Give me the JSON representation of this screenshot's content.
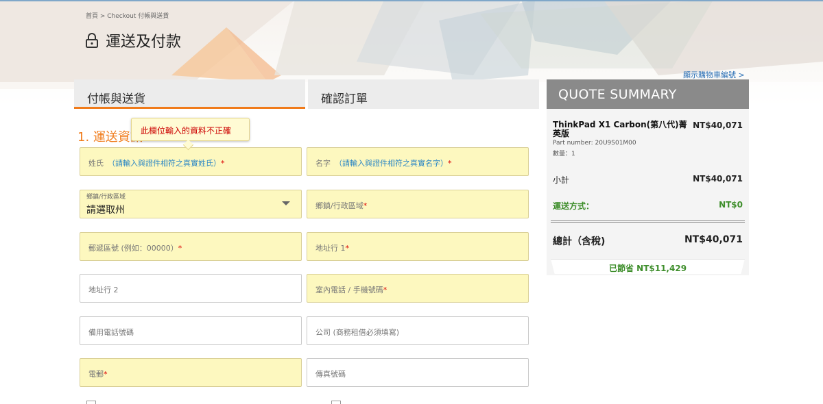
{
  "breadcrumb": "首頁 > Checkout 付帳與送貨",
  "page": {
    "title": "運送及付款"
  },
  "cart": {
    "show_number_link": "顯示購物車編號 >"
  },
  "tabs": {
    "billing": "付帳與送貨",
    "confirm": "確認訂單"
  },
  "section": {
    "title": "1. 運送資訊"
  },
  "tooltip": {
    "error": "此欄位輸入的資料不正確"
  },
  "form": {
    "last_name": {
      "label": "姓氏",
      "hint": "（請輸入與證件相符之真實姓氏）",
      "req": "*"
    },
    "first_name": {
      "label": "名字",
      "hint": "（請輸入與證件相符之真實名字）",
      "req": "*"
    },
    "township_select": {
      "label": "鄉鎮/行政區域",
      "value": "請選取州"
    },
    "township": {
      "label": "鄉鎮/行政區域",
      "req": "*"
    },
    "postal": {
      "label": "郵遞區號 (例如：00000）",
      "req": "*"
    },
    "address1": {
      "label": "地址行 1",
      "req": "*"
    },
    "address2": {
      "label": "地址行 2"
    },
    "phone": {
      "label": "室內電話 / 手機號碼",
      "req": "*"
    },
    "alt_phone": {
      "label": "備用電話號碼"
    },
    "company": {
      "label": "公司 (商務租借必須填寫)"
    },
    "email": {
      "label": "電郵",
      "req": "*"
    },
    "fax": {
      "label": "傳真號碼"
    }
  },
  "quote": {
    "header": "QUOTE SUMMARY",
    "product_name": "ThinkPad X1 Carbon(第八代)菁英版",
    "product_price": "NT$40,071",
    "part_number": "Part number: 20U9S01M00",
    "quantity": "數量：1",
    "subtotal_label": "小計",
    "subtotal_value": "NT$40,071",
    "shipping_label": "運送方式：",
    "shipping_value": "NT$0",
    "total_label": "總計（含稅)",
    "total_value": "NT$40,071",
    "savings_label": "已節省",
    "savings_value": "NT$11,429"
  },
  "colors": {
    "accent": "#f07b1a",
    "required_bg": "#fdf8bf",
    "savings": "#3e8e2b",
    "quote_header": "#8a8a8a"
  }
}
